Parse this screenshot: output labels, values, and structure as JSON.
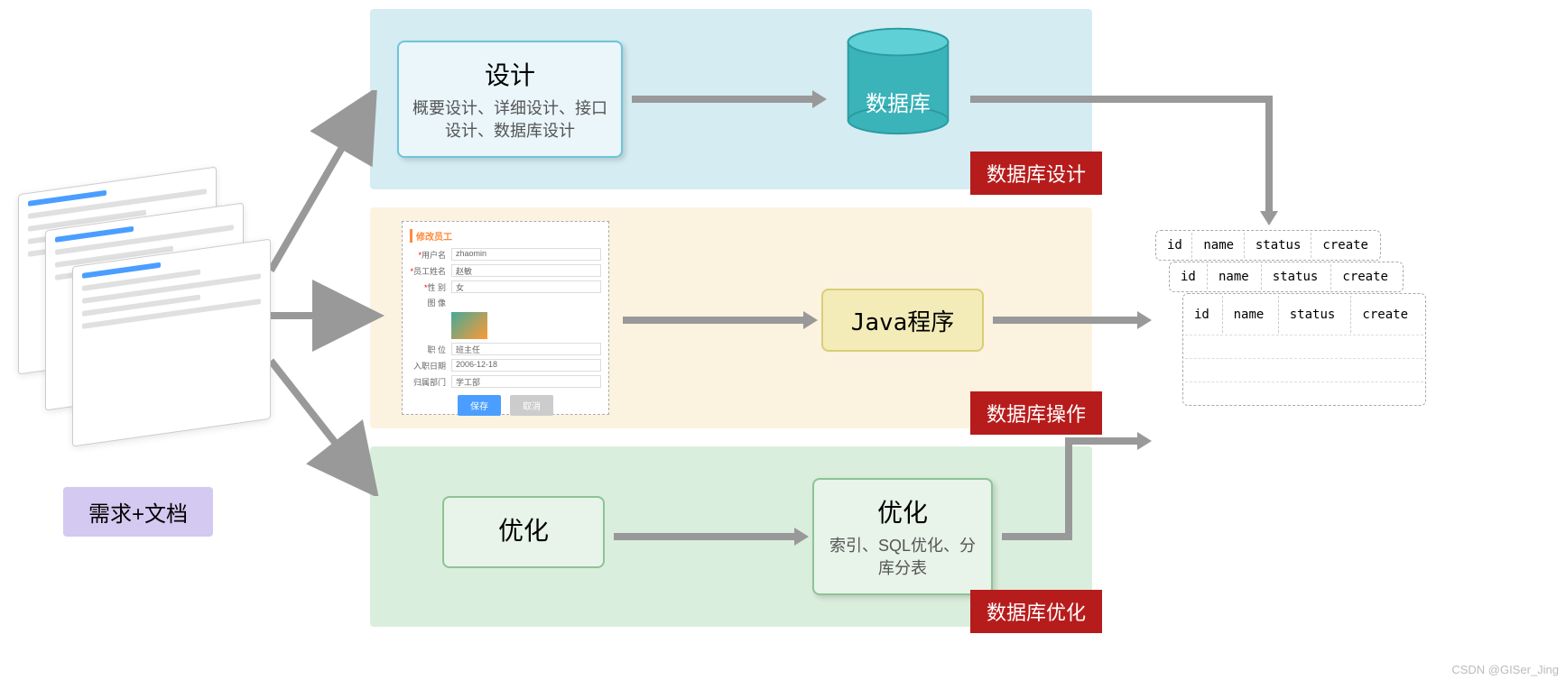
{
  "left_label": "需求+文档",
  "panels": {
    "design": {
      "title": "设计",
      "subtitle": "概要设计、详细设计、接口设计、数据库设计"
    },
    "database": {
      "label": "数据库"
    },
    "java": {
      "label": "Java程序"
    },
    "optimize1": {
      "title": "优化"
    },
    "optimize2": {
      "title": "优化",
      "subtitle": "索引、SQL优化、分库分表"
    }
  },
  "badges": {
    "design": "数据库设计",
    "operation": "数据库操作",
    "optimize": "数据库优化"
  },
  "form": {
    "title": "修改员工",
    "rows": {
      "username": {
        "label": "用户名",
        "value": "zhaomin"
      },
      "empname": {
        "label": "员工姓名",
        "value": "赵敏"
      },
      "gender": {
        "label": "性 别",
        "value": "女"
      },
      "image": {
        "label": "图 像"
      },
      "position": {
        "label": "职 位",
        "value": "班主任"
      },
      "hiredate": {
        "label": "入职日期",
        "value": "2006-12-18"
      },
      "dept": {
        "label": "归属部门",
        "value": "学工部"
      }
    },
    "buttons": {
      "save": "保存",
      "cancel": "取消"
    }
  },
  "table_headers": [
    "id",
    "name",
    "status",
    "create"
  ],
  "watermark": "CSDN @GISer_Jing"
}
